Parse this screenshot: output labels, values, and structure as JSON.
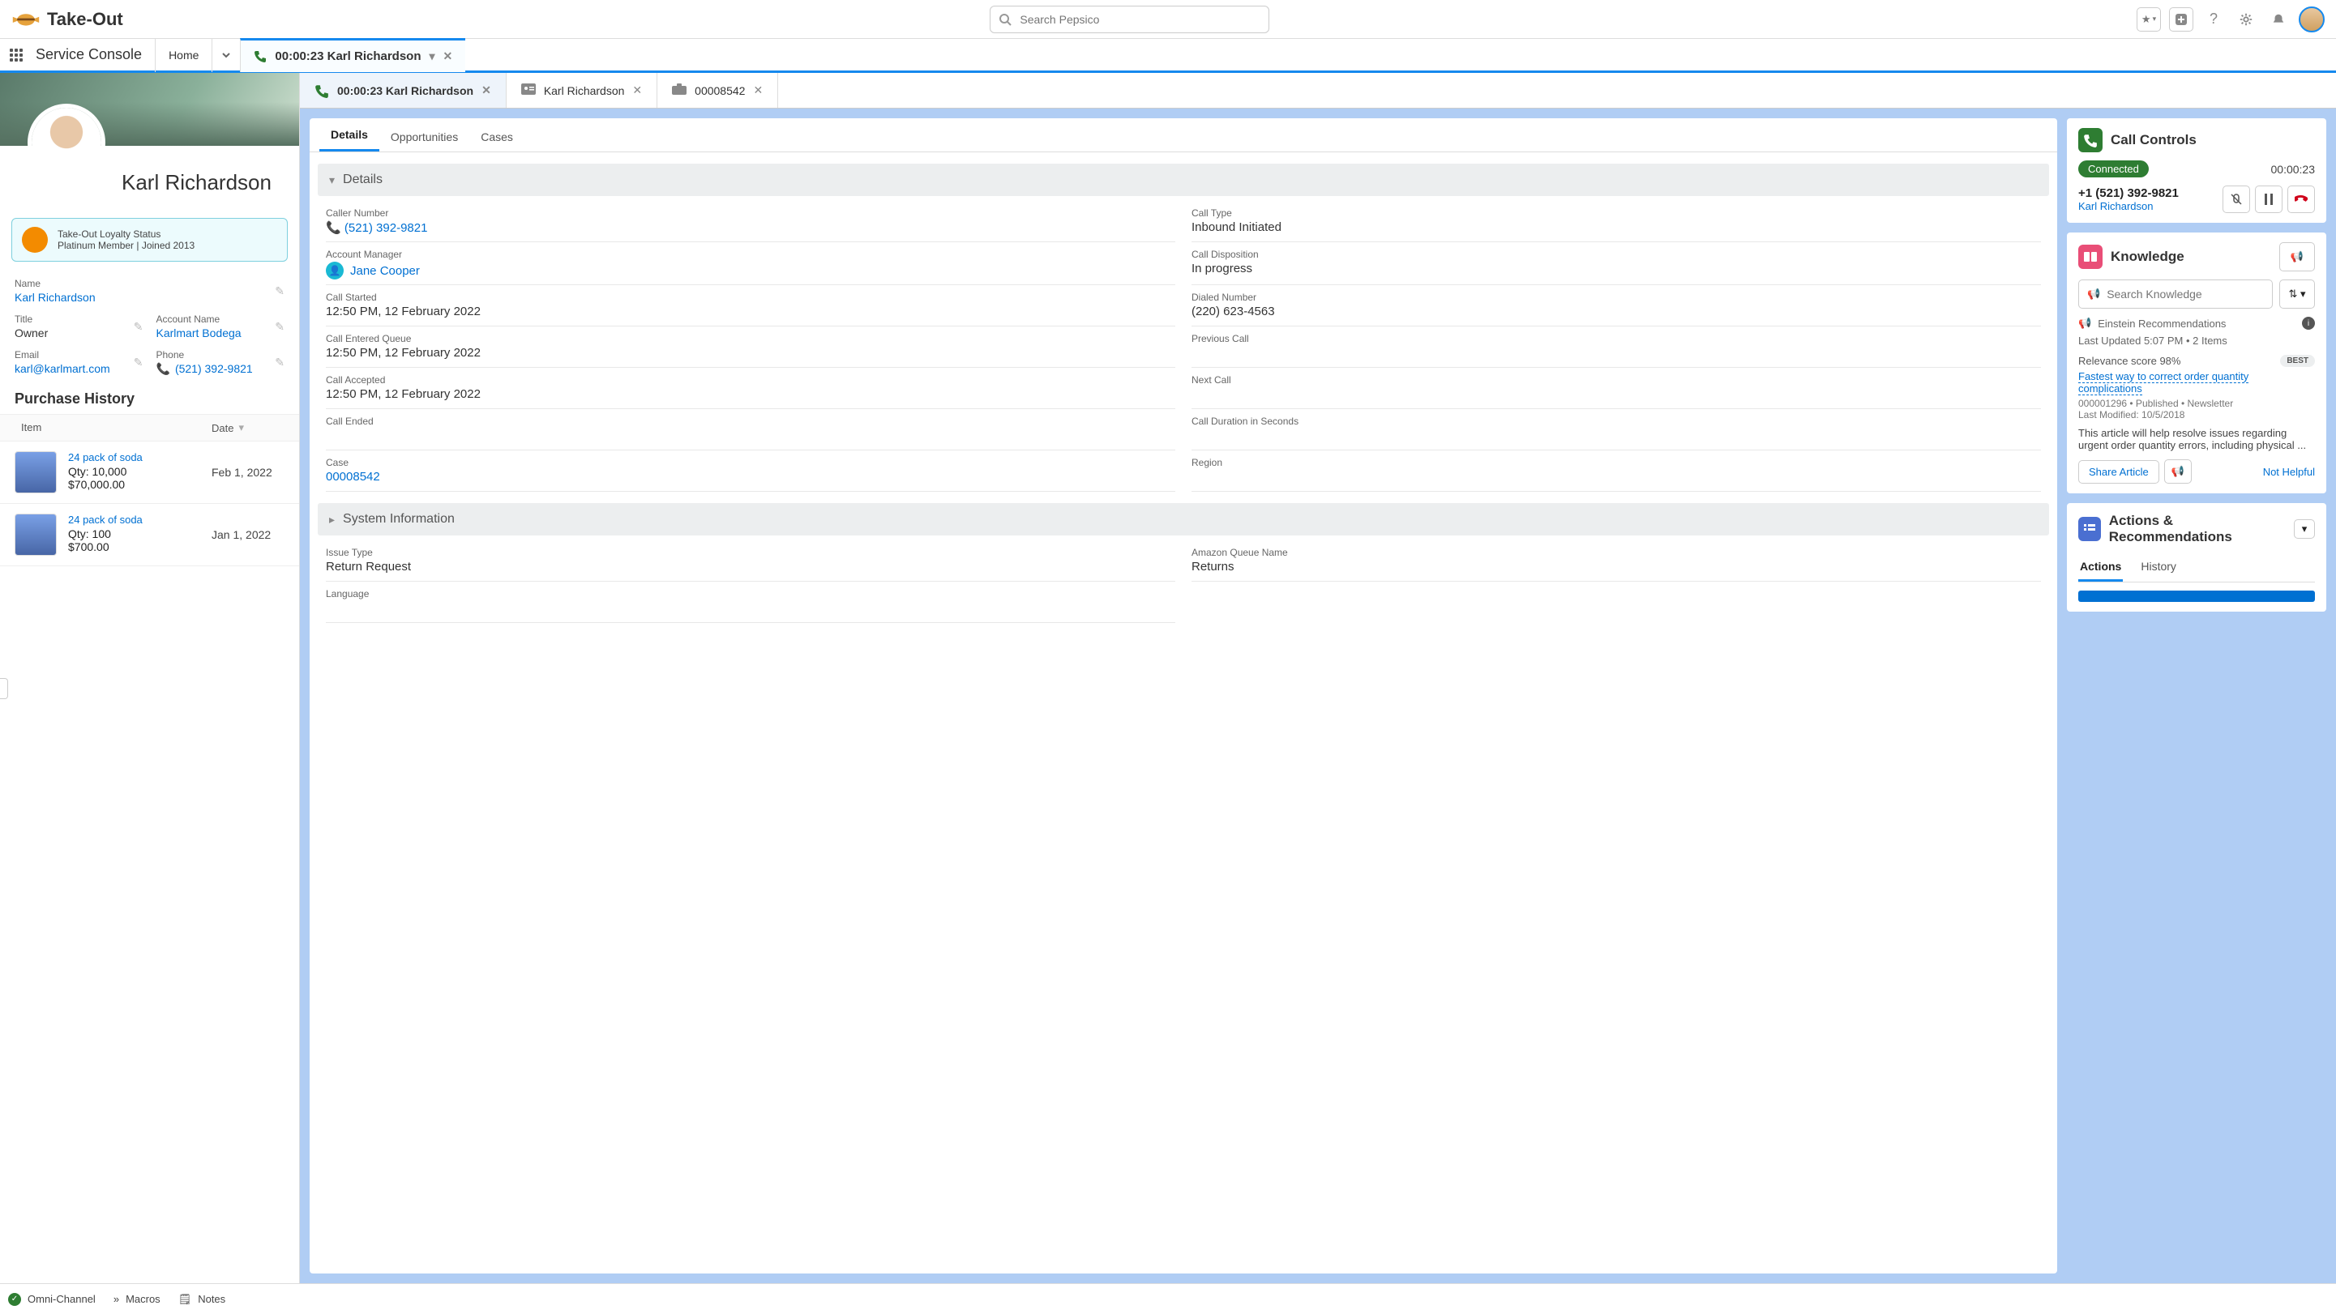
{
  "header": {
    "brand": "Take-Out",
    "search_placeholder": "Search Pepsico"
  },
  "nav": {
    "console": "Service Console",
    "home": "Home",
    "call_tab": "00:00:23 Karl Richardson"
  },
  "subtabs": {
    "call": "00:00:23 Karl Richardson",
    "contact": "Karl Richardson",
    "case": "00008542"
  },
  "contact": {
    "name": "Karl Richardson",
    "loyalty_title": "Take-Out Loyalty Status",
    "loyalty_line": "Platinum Member | Joined 2013",
    "fields": {
      "name_label": "Name",
      "name_value": "Karl Richardson",
      "title_label": "Title",
      "title_value": "Owner",
      "account_label": "Account Name",
      "account_value": "Karlmart Bodega",
      "email_label": "Email",
      "email_value": "karl@karlmart.com",
      "phone_label": "Phone",
      "phone_value": "(521) 392-9821"
    },
    "purchase_heading": "Purchase History",
    "ph_item": "Item",
    "ph_date": "Date",
    "purchases": [
      {
        "name": "24 pack of soda",
        "qty": "Qty: 10,000",
        "price": "$70,000.00",
        "date": "Feb 1, 2022"
      },
      {
        "name": "24 pack of soda",
        "qty": "Qty: 100",
        "price": "$700.00",
        "date": "Jan 1, 2022"
      }
    ]
  },
  "pane_tabs": {
    "details": "Details",
    "opps": "Opportunities",
    "cases": "Cases"
  },
  "details": {
    "section": "Details",
    "caller_number_l": "Caller Number",
    "caller_number_v": "(521) 392-9821",
    "call_type_l": "Call Type",
    "call_type_v": "Inbound Initiated",
    "acct_mgr_l": "Account Manager",
    "acct_mgr_v": "Jane Cooper",
    "disposition_l": "Call Disposition",
    "disposition_v": "In progress",
    "started_l": "Call Started",
    "started_v": "12:50 PM, 12 February 2022",
    "dialed_l": "Dialed Number",
    "dialed_v": "(220) 623-4563",
    "queue_l": "Call Entered Queue",
    "queue_v": "12:50 PM, 12 February 2022",
    "prev_l": "Previous Call",
    "prev_v": "",
    "accepted_l": "Call Accepted",
    "accepted_v": "12:50 PM, 12 February 2022",
    "next_l": "Next Call",
    "next_v": "",
    "ended_l": "Call Ended",
    "ended_v": "",
    "duration_l": "Call Duration in Seconds",
    "duration_v": "",
    "case_l": "Case",
    "case_v": "00008542",
    "region_l": "Region",
    "region_v": "",
    "sysinfo": "System Information",
    "issue_l": "Issue Type",
    "issue_v": "Return Request",
    "aqueue_l": "Amazon Queue Name",
    "aqueue_v": "Returns",
    "lang_l": "Language"
  },
  "call_controls": {
    "title": "Call Controls",
    "status": "Connected",
    "timer": "00:00:23",
    "number": "+1 (521) 392-9821",
    "name": "Karl Richardson"
  },
  "knowledge": {
    "title": "Knowledge",
    "search_ph": "Search Knowledge",
    "rec": "Einstein Recommendations",
    "updated": "Last Updated 5:07 PM • 2 Items",
    "score": "Relevance score 98%",
    "best": "BEST",
    "article": "Fastest way to correct order quantity complications",
    "meta": "000001296  •  Published  •  Newsletter",
    "modified": "Last Modified: 10/5/2018",
    "snippet": "This article will help resolve issues regarding urgent order quantity errors, including physical ...",
    "share": "Share Article",
    "not_helpful": "Not Helpful"
  },
  "actions": {
    "title": "Actions & Recommendations",
    "tab_actions": "Actions",
    "tab_history": "History"
  },
  "footer": {
    "omni": "Omni-Channel",
    "macros": "Macros",
    "notes": "Notes"
  }
}
